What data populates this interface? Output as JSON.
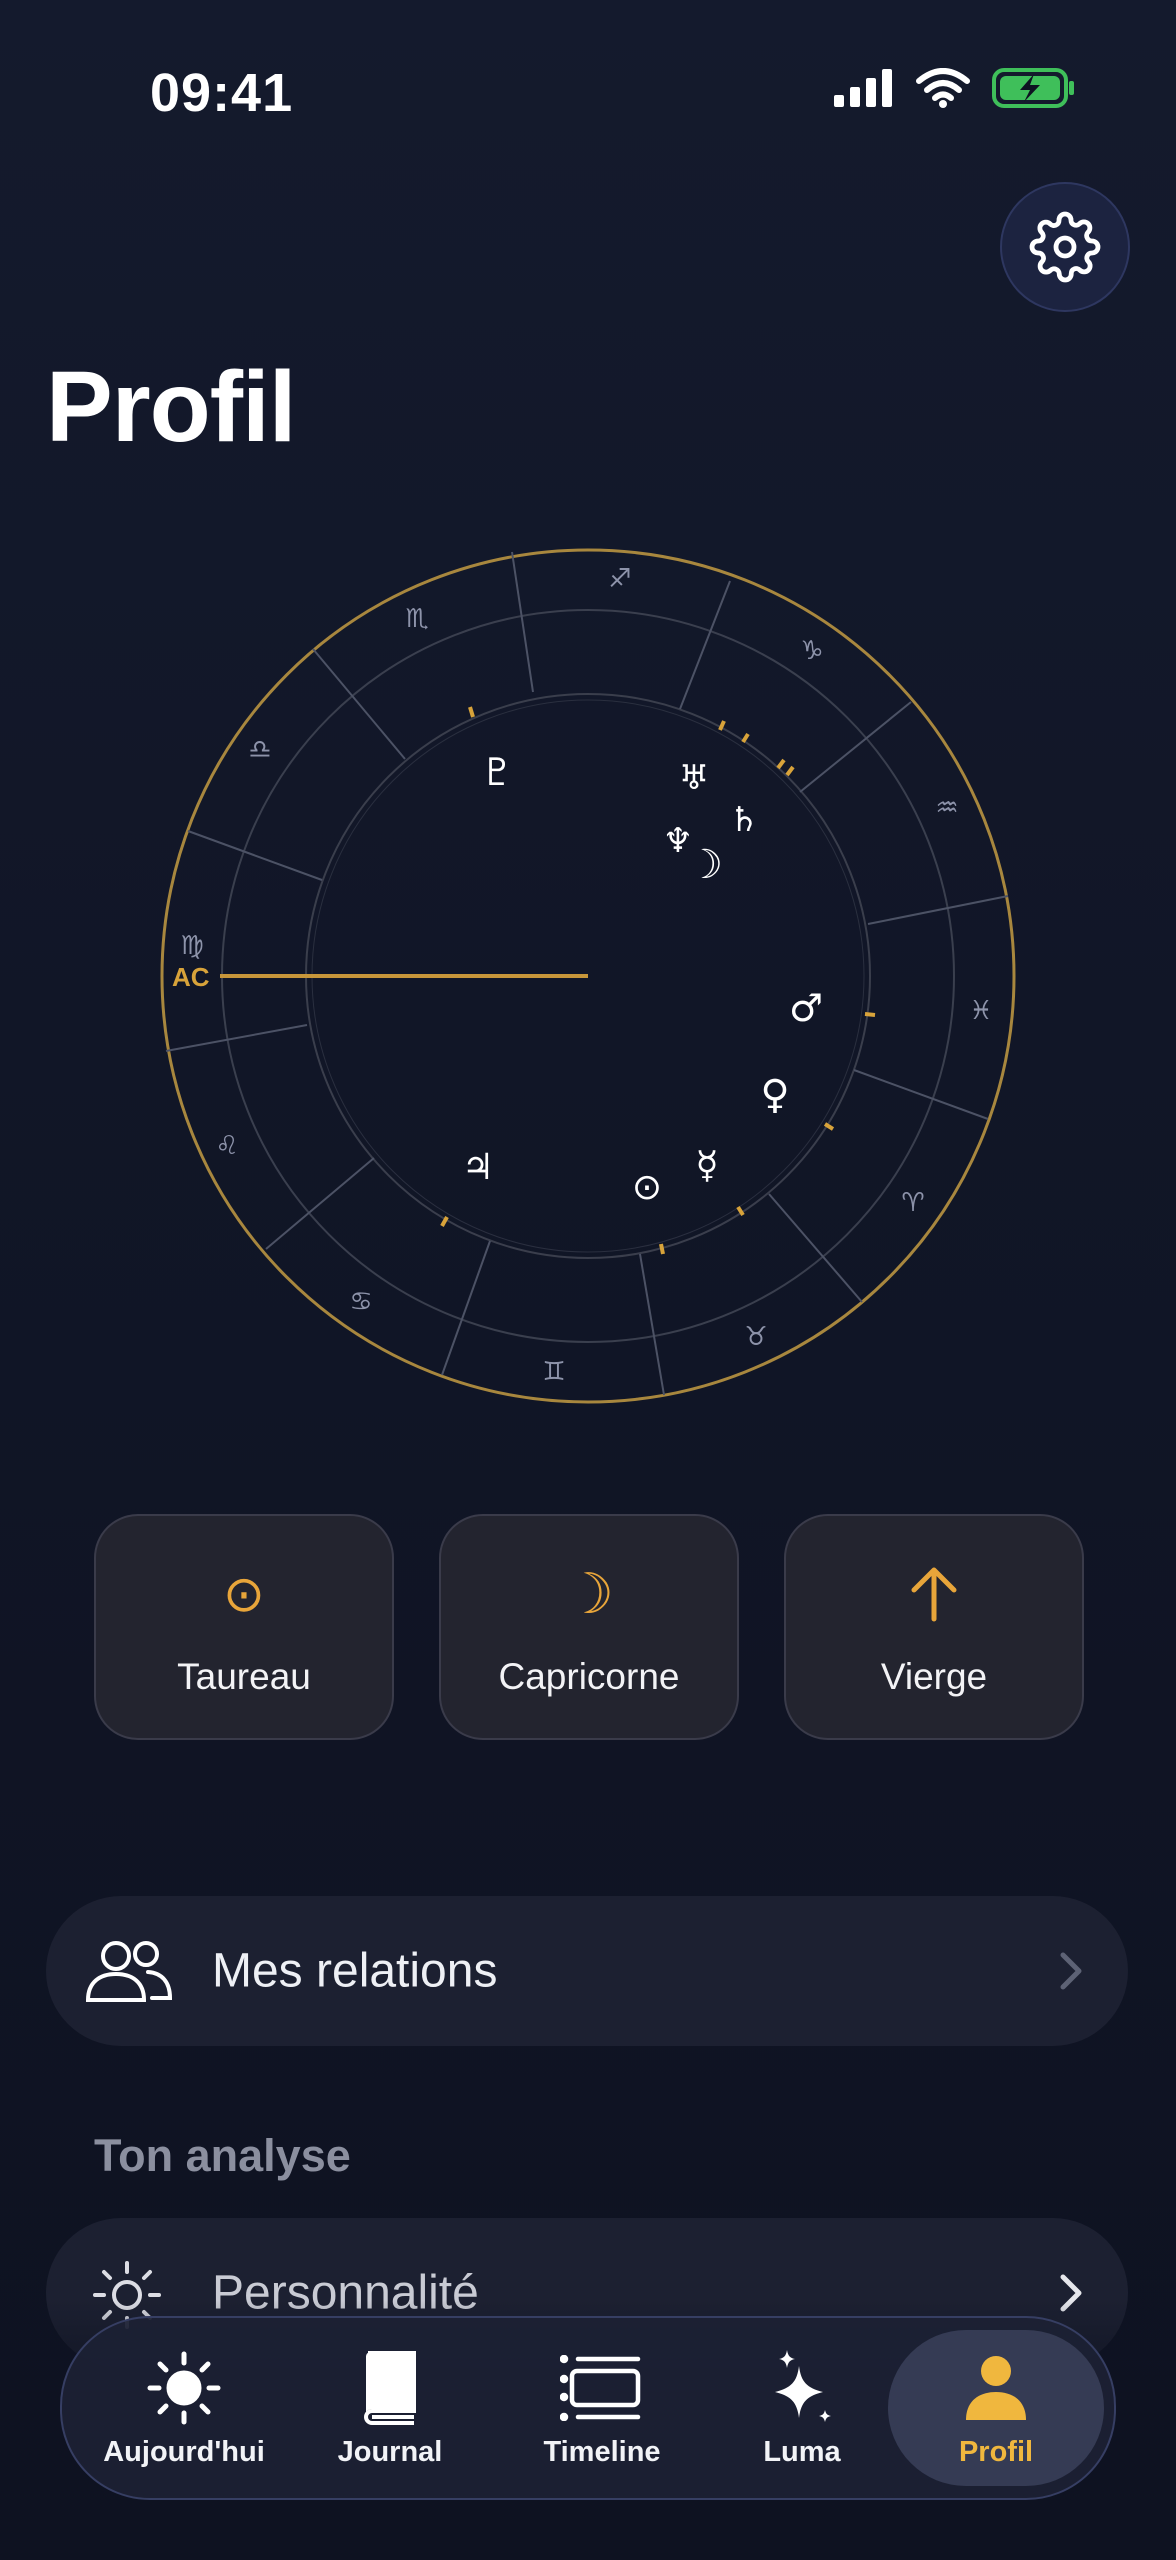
{
  "status_bar": {
    "time": "09:41"
  },
  "header": {
    "title": "Profil"
  },
  "chart": {
    "ascendant_label": "AC",
    "zodiac_glyphs": [
      "♐",
      "♑",
      "♒",
      "♓",
      "♈",
      "♉",
      "♊",
      "♋",
      "♌",
      "♍",
      "♎",
      "♏"
    ],
    "planets": [
      "♇",
      "♅",
      "♄",
      "♆",
      "☽",
      "♂",
      "♀",
      "☿",
      "⊙",
      "♃"
    ]
  },
  "big_three": [
    {
      "icon": "sun-icon",
      "glyph": "⊙",
      "label": "Taureau"
    },
    {
      "icon": "moon-icon",
      "glyph": "☽",
      "label": "Capricorne"
    },
    {
      "icon": "arrow-up-icon",
      "glyph": "↑",
      "label": "Vierge"
    }
  ],
  "relations": {
    "label": "Mes relations"
  },
  "analysis": {
    "section_title": "Ton analyse",
    "items": [
      {
        "label": "Personnalité"
      }
    ]
  },
  "tabbar": {
    "tabs": [
      {
        "label": "Aujourd'hui",
        "icon": "sun-icon"
      },
      {
        "label": "Journal",
        "icon": "book-icon"
      },
      {
        "label": "Timeline",
        "icon": "timeline-icon"
      },
      {
        "label": "Luma",
        "icon": "sparkles-icon"
      },
      {
        "label": "Profil",
        "icon": "person-icon",
        "active": true
      }
    ]
  },
  "colors": {
    "accent": "#e8a53a",
    "background": "#111627",
    "card": "#23242f"
  }
}
